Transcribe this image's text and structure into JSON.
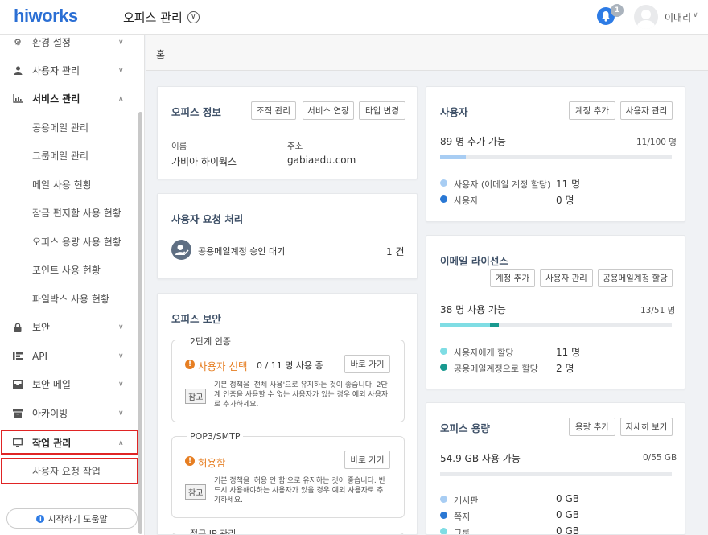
{
  "header": {
    "logo": "hiworks",
    "title": "오피스 관리",
    "notification_count": "1",
    "user_name": "이대리"
  },
  "sidebar": {
    "items": [
      {
        "label": "환경 설정",
        "icon": "gear-icon"
      },
      {
        "label": "사용자 관리",
        "icon": "user-icon"
      },
      {
        "label": "서비스 관리",
        "icon": "chart-icon"
      },
      {
        "label": "보안",
        "icon": "lock-icon"
      },
      {
        "label": "API",
        "icon": "api-icon"
      },
      {
        "label": "보안 메일",
        "icon": "secure-mail-icon"
      },
      {
        "label": "아카이빙",
        "icon": "archive-icon"
      },
      {
        "label": "작업 관리",
        "icon": "monitor-icon"
      }
    ],
    "service_sub": [
      "공용메일 관리",
      "그룹메일 관리",
      "메일 사용 현황",
      "잠금 편지함 사용 현황",
      "오피스 용량 사용 현황",
      "포인트 사용 현황",
      "파일박스 사용 현황"
    ],
    "task_sub": [
      "사용자 요청 작업"
    ],
    "help_label": "시작하기 도움말"
  },
  "breadcrumb": "홈",
  "office_info": {
    "title": "오피스 정보",
    "buttons": [
      "조직 관리",
      "서비스 연장",
      "타입 변경"
    ],
    "name_label": "이름",
    "name_value": "가비아 하이웍스",
    "address_label": "주소",
    "address_value": "gabiaedu.com"
  },
  "user_requests": {
    "title": "사용자 요청 처리",
    "item_label": "공용메일계정 승인 대기",
    "item_count": "1 건"
  },
  "office_security": {
    "title": "오피스 보안",
    "two_factor": {
      "title": "2단계 인증",
      "status": "사용자 선택",
      "count": "0 / 11 명 사용 중",
      "button": "바로 가기",
      "chip": "참고",
      "note": "기본 정책을 '전체 사용'으로 유지하는 것이 좋습니다. 2단계 인증을 사용할 수 없는 사용자가 있는 경우 예외 사용자로 추가하세요."
    },
    "pop3": {
      "title": "POP3/SMTP",
      "status": "허용함",
      "button": "바로 가기",
      "chip": "참고",
      "note": "기본 정책을 '허용 안 함'으로 유지하는 것이 좋습니다. 반드시 사용해야하는 사용자가 있을 경우 예외 사용자로 추가하세요."
    },
    "ip": {
      "title": "접근 IP 관리"
    }
  },
  "users": {
    "title": "사용자",
    "buttons": [
      "계정 추가",
      "사용자 관리"
    ],
    "available": "89 명 추가 가능",
    "ratio": "11/100 명",
    "fill": 0.11,
    "legend": [
      {
        "label": "사용자 (이메일 계정 할당)",
        "value": "11 명",
        "color": "#a8cdf3"
      },
      {
        "label": "사용자",
        "value": "0 명",
        "color": "#2a78d4"
      }
    ]
  },
  "email_license": {
    "title": "이메일 라이선스",
    "buttons": [
      "계정 추가",
      "사용자 관리",
      "공용메일계정 할당"
    ],
    "usable": "38 명 사용 가능",
    "ratio": "13/51 명",
    "fill_users": 0.216,
    "fill_shared": 0.039,
    "legend": [
      {
        "label": "사용자에게 할당",
        "value": "11 명",
        "color": "#7fdde4"
      },
      {
        "label": "공용메일계정으로 할당",
        "value": "2 명",
        "color": "#18998f"
      }
    ]
  },
  "office_storage": {
    "title": "오피스 용량",
    "buttons": [
      "용량 추가",
      "자세히 보기"
    ],
    "usable": "54.9 GB 사용 가능",
    "ratio": "0/55 GB",
    "fill": 0.0,
    "legend": [
      {
        "label": "게시판",
        "value": "0 GB",
        "color": "#a8cdf3"
      },
      {
        "label": "쪽지",
        "value": "0 GB",
        "color": "#2a78d4"
      },
      {
        "label": "그룹",
        "value": "0 GB",
        "color": "#7fdde4"
      }
    ]
  }
}
